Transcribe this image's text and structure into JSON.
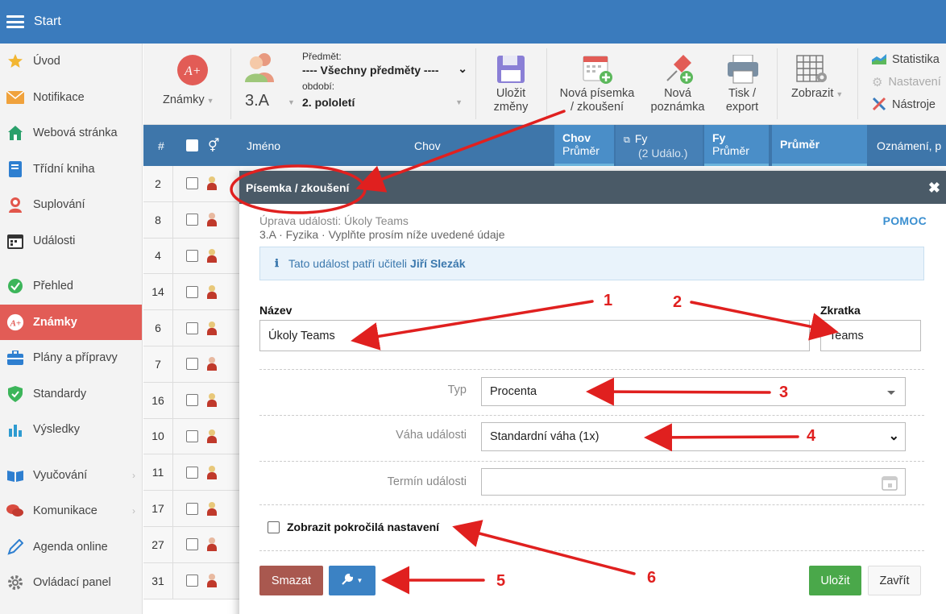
{
  "app": {
    "title": "Start"
  },
  "sidebar": {
    "items": [
      {
        "label": "Úvod",
        "icon": "star-icon"
      },
      {
        "label": "Notifikace",
        "icon": "envelope-icon"
      },
      {
        "label": "Webová stránka",
        "icon": "house-icon"
      },
      {
        "label": "Třídní kniha",
        "icon": "book-icon"
      },
      {
        "label": "Suplování",
        "icon": "person-icon"
      },
      {
        "label": "Události",
        "icon": "calendar-icon"
      },
      {
        "label": "Přehled",
        "icon": "check-circle-icon"
      },
      {
        "label": "Známky",
        "icon": "grade-icon",
        "active": true
      },
      {
        "label": "Plány a přípravy",
        "icon": "briefcase-icon"
      },
      {
        "label": "Standardy",
        "icon": "shield-icon"
      },
      {
        "label": "Výsledky",
        "icon": "bar-chart-icon"
      },
      {
        "label": "Vyučování",
        "icon": "open-book-icon"
      },
      {
        "label": "Komunikace",
        "icon": "chat-icon"
      },
      {
        "label": "Agenda online",
        "icon": "pencil-icon"
      },
      {
        "label": "Ovládací panel",
        "icon": "gear-icon"
      }
    ]
  },
  "toolbar": {
    "grades_label": "Známky",
    "class_label": "3.A",
    "subject_caption": "Předmět:",
    "subject_value": "---- Všechny předměty ----",
    "period_caption": "období:",
    "period_value": "2. pololetí",
    "save_label_1": "Uložit",
    "save_label_2": "změny",
    "new_test_label_1": "Nová písemka",
    "new_test_label_2": "/ zkoušení",
    "new_note_label_1": "Nová",
    "new_note_label_2": "poznámka",
    "print_label_1": "Tisk /",
    "print_label_2": "export",
    "show_label": "Zobrazit",
    "stats_label": "Statistika",
    "settings_label": "Nastavení",
    "tools_label": "Nástroje"
  },
  "table": {
    "col_hash": "#",
    "col_name": "Jméno",
    "col_chov": "Chov",
    "col_chov_avg_1": "Chov",
    "col_chov_avg_2": "Průměr",
    "col_fy_1": "Fy",
    "col_fy_2": "(2 Událo.)",
    "col_fy_avg_1": "Fy",
    "col_fy_avg_2": "Průměr",
    "col_avg": "Průměr",
    "col_notice": "Oznámení, p",
    "row_numbers": [
      "2",
      "8",
      "4",
      "14",
      "6",
      "7",
      "16",
      "10",
      "11",
      "17",
      "27",
      "31"
    ]
  },
  "dialog": {
    "title": "Písemka / zkoušení",
    "edit_subtitle": "Úprava události: Úkoly Teams",
    "context": "3.A · Fyzika · Vyplňte prosím níže uvedené údaje",
    "help": "POMOC",
    "info_prefix": "Tato událost patří učiteli",
    "info_teacher": "Jiří Slezák",
    "name_label": "Název",
    "name_value": "Úkoly Teams",
    "abbr_label": "Zkratka",
    "abbr_value": "Teams",
    "type_label": "Typ",
    "type_value": "Procenta",
    "weight_label": "Váha události",
    "weight_value": "Standardní váha (1x)",
    "date_label": "Termín události",
    "date_value": "",
    "advanced_label": "Zobrazit pokročilá nastavení",
    "delete_label": "Smazat",
    "save_label": "Uložit",
    "close_label": "Zavřít"
  },
  "annotations": [
    "1",
    "2",
    "3",
    "4",
    "5",
    "6"
  ],
  "colors": {
    "topbar": "#3a7bbd",
    "active_sidebar": "#e25c56",
    "table_header": "#3e76aa",
    "dialog_header": "#4a5a67",
    "delete_button": "#a9584f",
    "tools_button": "#3b82c4",
    "save_button": "#4aa84a",
    "annotation": "#e0201f"
  }
}
